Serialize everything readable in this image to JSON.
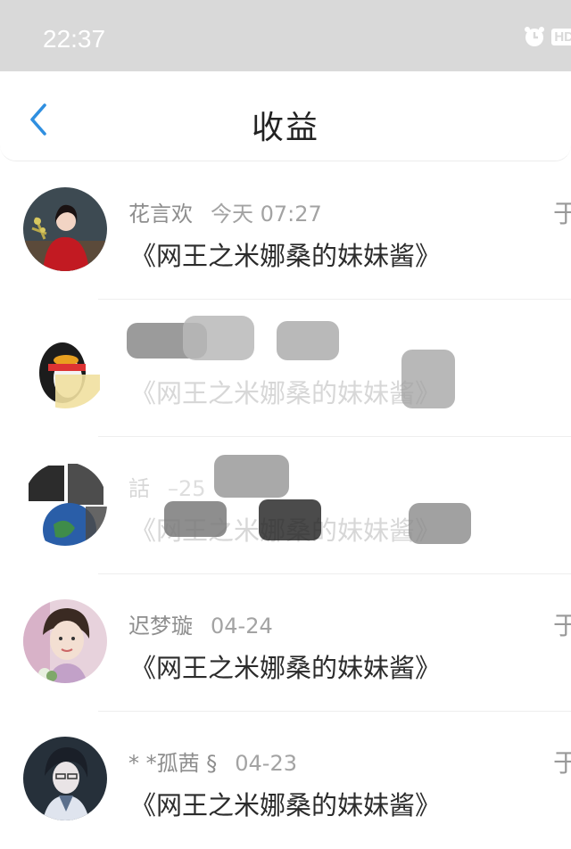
{
  "status_bar": {
    "time": "22:37",
    "hd": "HD"
  },
  "header": {
    "title": "收益"
  },
  "rows": [
    {
      "name": "花言欢",
      "time": "今天 07:27",
      "book": "《网王之米娜桑的妹妹酱》",
      "trail": "于"
    },
    {
      "name": "",
      "time": "",
      "book": "《网王之米娜桑的妹妹酱》",
      "trail": ""
    },
    {
      "name": "話",
      "time": "–25",
      "book": "《网王之米娜桑的妹妹酱》",
      "trail": ""
    },
    {
      "name": "迟梦璇",
      "time": "04-24",
      "book": "《网王之米娜桑的妹妹酱》",
      "trail": "于"
    },
    {
      "name": "* *孤茜 §",
      "time": "04-23",
      "book": "《网王之米娜桑的妹妹酱》",
      "trail": "于"
    }
  ]
}
